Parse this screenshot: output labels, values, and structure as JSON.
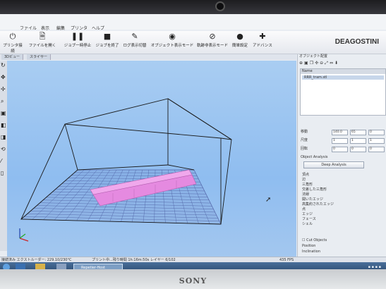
{
  "menu": [
    "ファイル",
    "表示",
    "編集",
    "プリンタ",
    "ヘルプ"
  ],
  "toolbar": {
    "items": [
      {
        "label": "プリンタ接続",
        "icon": "power-icon"
      },
      {
        "label": "ファイルを開く",
        "icon": "file-icon"
      },
      {
        "label": "ジョブ一時停止",
        "icon": "pause-icon"
      },
      {
        "label": "ジョブを終了",
        "icon": "stop-icon"
      },
      {
        "label": "ログ表示切替",
        "icon": "pencil-icon"
      },
      {
        "label": "オブジェクト表示モード",
        "icon": "eye-icon"
      },
      {
        "label": "軌跡非表示モード",
        "icon": "eye-slash-icon"
      },
      {
        "label": "簡単設定",
        "icon": "user-icon"
      },
      {
        "label": "アドバンス",
        "icon": "wrench-icon"
      }
    ],
    "logo": "DEAGOSTINI"
  },
  "tabs": [
    "3Dビュー",
    "スライサー"
  ],
  "panel": {
    "title": "オブジェクト配置",
    "list_header": "Name",
    "list_item": "RRR_tram.stl",
    "transform": [
      {
        "label": "移動",
        "values": [
          "140.0",
          "65",
          "0"
        ]
      },
      {
        "label": "尺度",
        "values": [
          "1",
          "1",
          "1"
        ]
      },
      {
        "label": "回転",
        "values": [
          "0",
          "0",
          "0"
        ]
      }
    ],
    "analysis_title": "Object Analysis",
    "analysis_button": "Deep Analysis",
    "stats": [
      "頂点",
      "辺",
      "三角形",
      "交差した三角形",
      "法線",
      "開いたエッジ",
      "高集約されたエッジ",
      "点",
      "エッジ",
      "フェース",
      "シェル"
    ],
    "cut_label": "Cut Objects",
    "position_label": "Position",
    "inclination_label": "Inclination"
  },
  "status": {
    "left": "接続済み  エクストルーダー: 229.10/230°C",
    "middle": "プリント中...残り時間 1h:16m:50s  レイヤー 6/102",
    "fps": "435 FPS"
  },
  "taskbar": {
    "active_window": "Repetier-Host"
  },
  "brand": "SONY",
  "colors": {
    "viewport_bg": "#9ec6f0",
    "print_object": "#e58ae0",
    "grid": "#5a6cb0"
  }
}
